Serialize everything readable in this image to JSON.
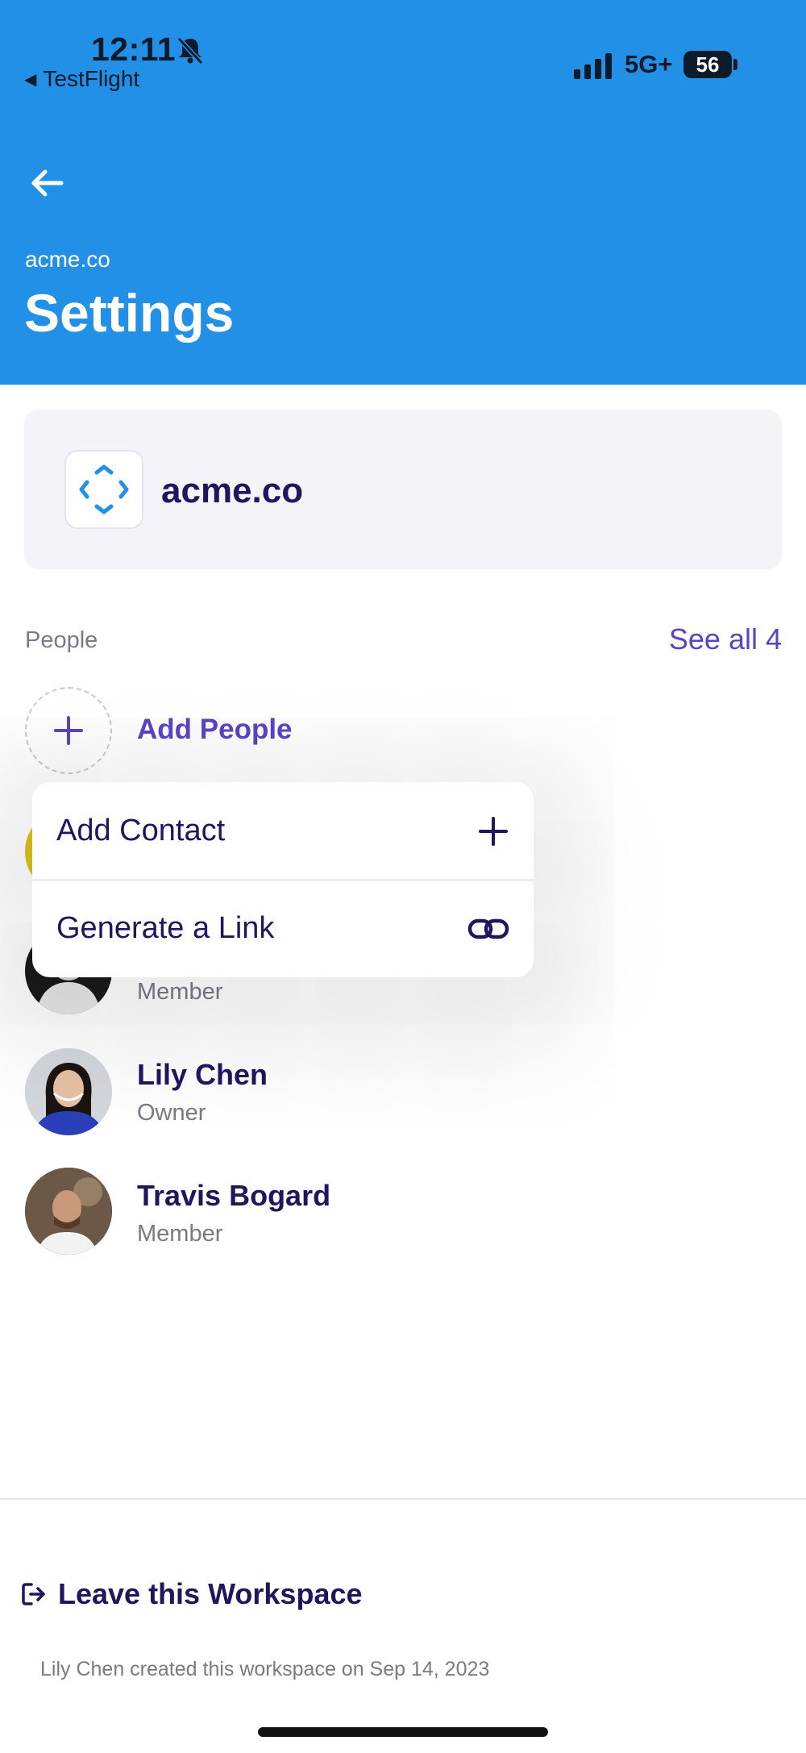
{
  "status_bar": {
    "time": "12:11",
    "back_app": "TestFlight",
    "network": "5G+",
    "battery": "56"
  },
  "header": {
    "workspace": "acme.co",
    "title": "Settings",
    "bg_color": "#2290e6"
  },
  "workspace_card": {
    "name": "acme.co",
    "logo_icon": "workspace-logo-icon"
  },
  "people": {
    "section_label": "People",
    "see_all": "See all 4",
    "add_people_label": "Add People",
    "members": [
      {
        "name": "",
        "role": ""
      },
      {
        "name": "",
        "role": "Member"
      },
      {
        "name": "Lily Chen",
        "role": "Owner"
      },
      {
        "name": "Travis Bogard",
        "role": "Member"
      }
    ]
  },
  "popup_menu": {
    "items": [
      {
        "label": "Add Contact",
        "icon": "plus-icon"
      },
      {
        "label": "Generate a Link",
        "icon": "link-icon"
      }
    ]
  },
  "footer": {
    "leave_label": "Leave this Workspace",
    "created_note": "Lily Chen created this workspace on Sep 14, 2023"
  },
  "colors": {
    "accent": "#5b43c9",
    "text_dark": "#1f1660",
    "muted": "#7a7a85"
  }
}
